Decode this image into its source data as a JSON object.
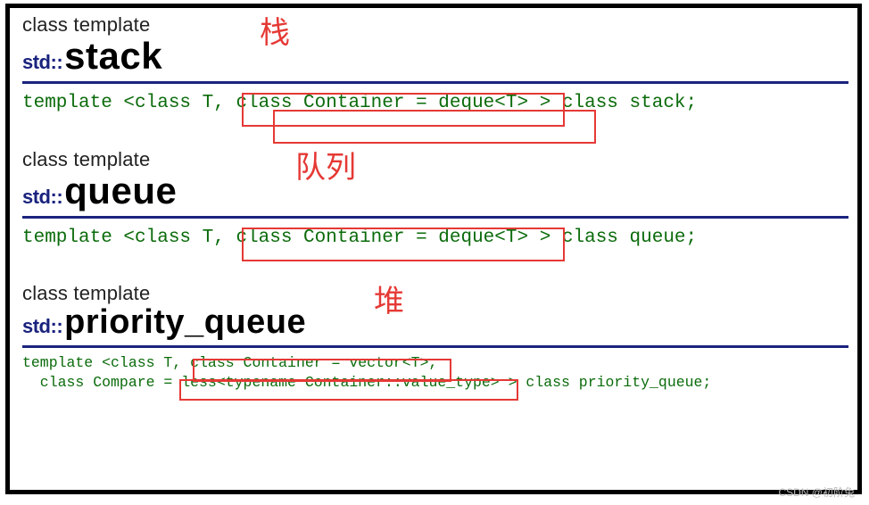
{
  "sections": [
    {
      "kind_label": "class template",
      "namespace": "std::",
      "class_name": "stack",
      "annotation": "栈",
      "signature": "template <class T, class Container = deque<T> > class stack;",
      "highlight_text": "class Container = deque<T>"
    },
    {
      "kind_label": "class template",
      "namespace": "std::",
      "class_name": "queue",
      "annotation": "队列",
      "signature": "template <class T, class Container = deque<T> > class queue;",
      "highlight_text": "class Container = deque<T>"
    },
    {
      "kind_label": "class template",
      "namespace": "std::",
      "class_name": "priority_queue",
      "annotation": "堆",
      "signature_line1": "template <class T, class Container = vector<T>,",
      "signature_line2": "  class Compare = less<typename Container::value_type> > class priority_queue;",
      "highlight1_text": "class Container = vector<T>",
      "highlight2_text": "less<typename Container::value_type>"
    }
  ],
  "watermark": "CSDN @初阶兔"
}
